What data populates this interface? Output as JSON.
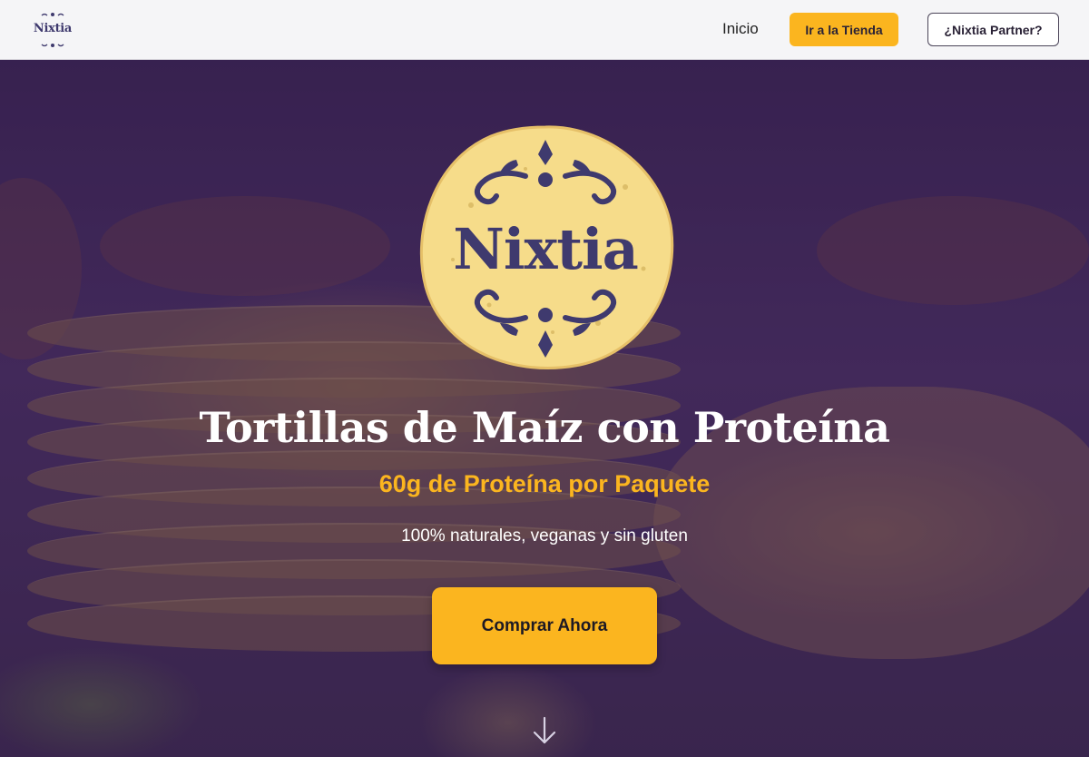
{
  "nav": {
    "logo_text": "Nixtia",
    "inicio_label": "Inicio",
    "store_button_label": "Ir a la Tienda",
    "partner_button_label": "¿Nixtia Partner?"
  },
  "hero": {
    "emblem_text": "Nixtia",
    "title": "Tortillas de Maíz con Proteína",
    "subtitle": "60g de Proteína por Paquete",
    "tagline": "100% naturales, veganas y sin gluten",
    "cta_label": "Comprar Ahora",
    "scroll_icon": "arrow-down-icon"
  },
  "colors": {
    "accent": "#fbb51f",
    "brand_purple": "#3f3a6e",
    "hero_overlay": "#3a2450",
    "nav_bg": "#f5f5f7"
  }
}
